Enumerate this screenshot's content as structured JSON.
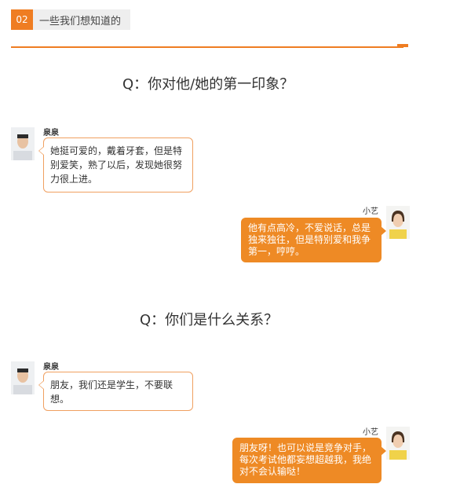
{
  "section": {
    "number": "02",
    "title": "一些我们想知道的"
  },
  "colors": {
    "accent": "#ef7d22",
    "bubble_right": "#ee8a25",
    "bubble_left_border": "#f0a060"
  },
  "questions": [
    {
      "text": "Q：你对他/她的第一印象？",
      "left_name": "泉泉",
      "left_lines": [
        "她挺可爱的，戴着牙套，但是特",
        "别爱笑，熟了以后，发现她很努",
        "力很上进。"
      ],
      "right_name": "小艺",
      "right_lines": [
        "他有点高冷，不爱说话，总是",
        "独来独往，但是特别爱和我争",
        "第一，哼哼。"
      ]
    },
    {
      "text": "Q：你们是什么关系？",
      "left_name": "泉泉",
      "left_lines": [
        "朋友，我们还是学生，不要联",
        "想。"
      ],
      "right_name": "小艺",
      "right_lines": [
        "朋友呀！也可以说是竞争对手，",
        "每次考试他都妄想超越我，我绝",
        "对不会认输哒！"
      ]
    }
  ]
}
